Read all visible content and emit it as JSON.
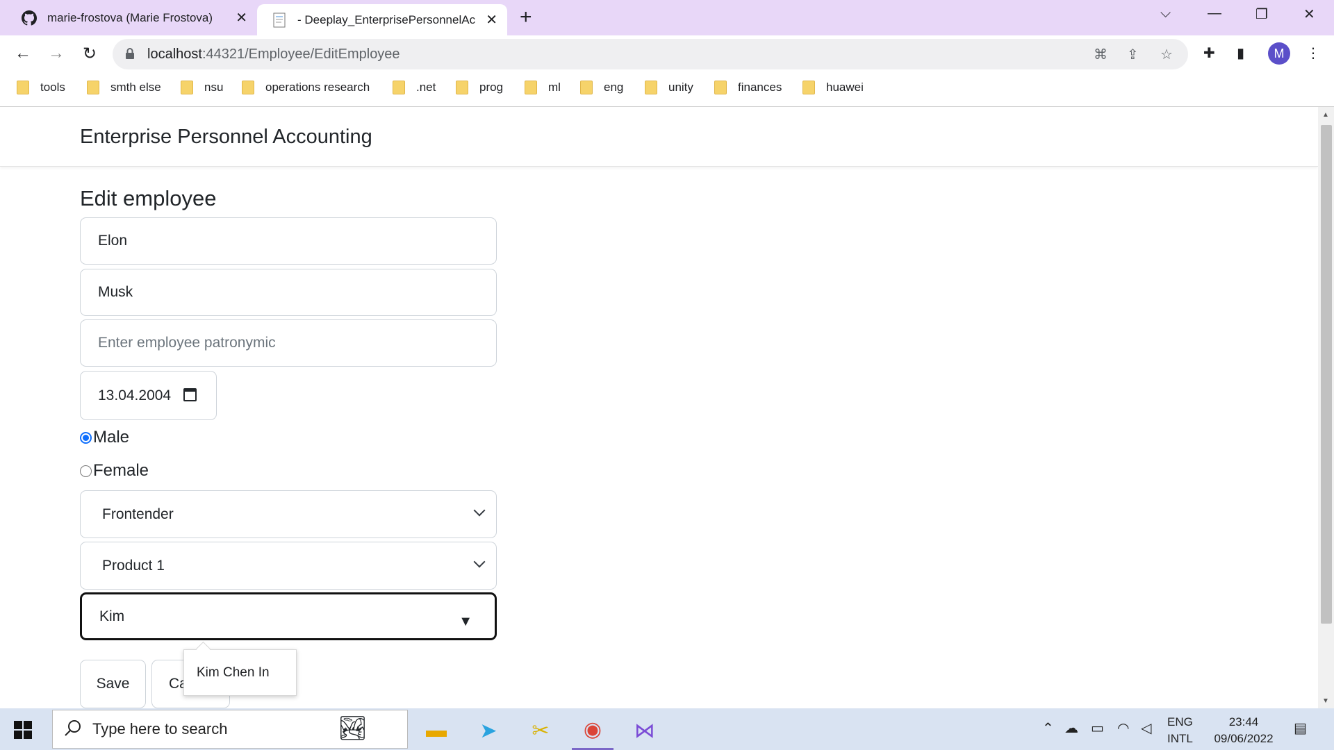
{
  "browser": {
    "tabs": [
      {
        "title": "marie-frostova (Marie Frostova)",
        "icon": "github-icon"
      },
      {
        "title": "- Deeplay_EnterprisePersonnelAc",
        "icon": "page-icon"
      }
    ],
    "url_host": "localhost",
    "url_path": ":44321/Employee/EditEmployee",
    "avatar_letter": "M",
    "accent_color": "#e8d7f8",
    "bookmarks": [
      "tools",
      "smth else",
      "nsu",
      "operations research",
      ".net",
      "prog",
      "ml",
      "eng",
      "unity",
      "finances",
      "huawei"
    ]
  },
  "app": {
    "brand": "Enterprise Personnel Accounting",
    "heading": "Edit employee",
    "form": {
      "first_name": "Elon",
      "last_name": "Musk",
      "patronymic_placeholder": "Enter employee patronymic",
      "birth_date": "13.04.2004",
      "gender_options": [
        "Male",
        "Female"
      ],
      "gender_selected": "Male",
      "position": "Frontender",
      "product": "Product 1",
      "manager": "Kim",
      "manager_suggestion": "Kim Chen In"
    },
    "buttons": {
      "save": "Save",
      "cancel": "Ca"
    }
  },
  "taskbar": {
    "search_placeholder": "Type here to search",
    "lang_top": "ENG",
    "lang_bottom": "INTL",
    "time": "23:44",
    "date": "09/06/2022"
  }
}
